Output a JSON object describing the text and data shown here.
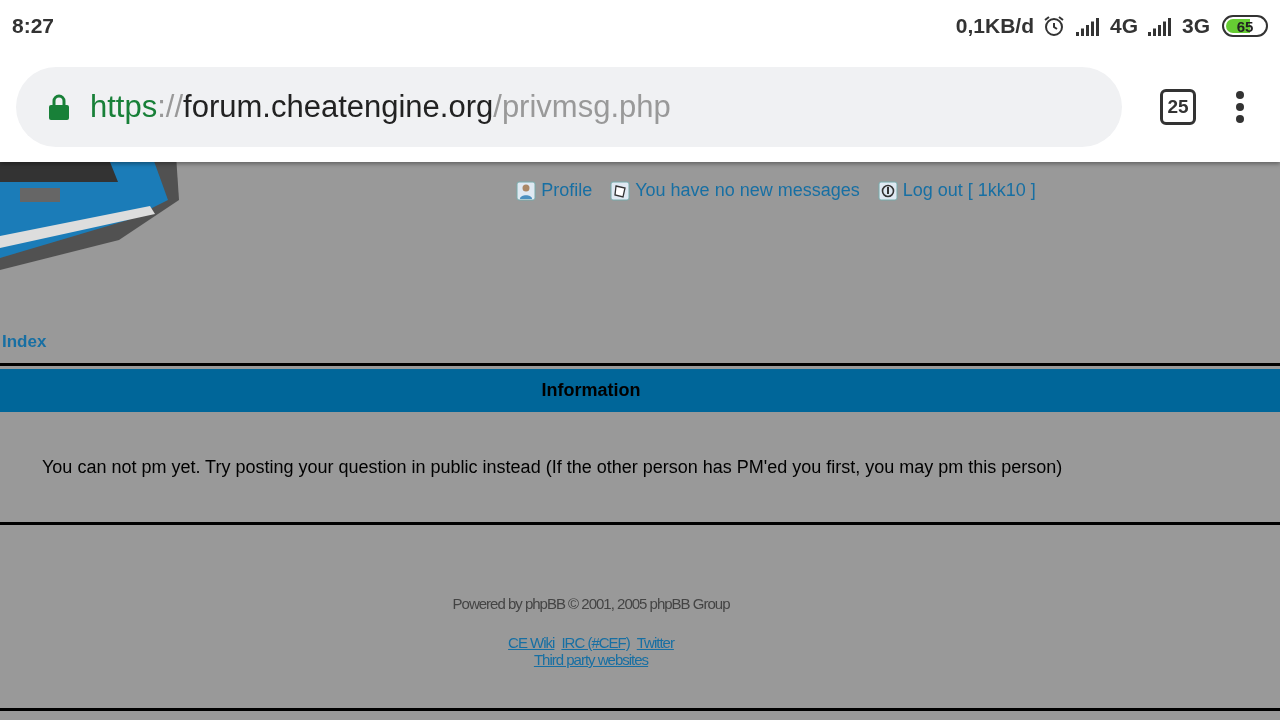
{
  "status_bar": {
    "time": "8:27",
    "data_rate": "0,1KB/d",
    "networks": [
      "4G",
      "3G"
    ],
    "battery": "65"
  },
  "address_bar": {
    "scheme": "https",
    "separator": "://",
    "host": "forum.cheatengine.org",
    "path": "/privmsg.php",
    "tab_count": "25"
  },
  "nav_links": [
    {
      "label": "Profile"
    },
    {
      "label": "You have no new messages"
    },
    {
      "label": "Log out [ 1kk10 ]"
    }
  ],
  "breadcrumb": "Index",
  "panel": {
    "title": "Information",
    "message": "You can not pm yet. Try posting your question in public instead (If the other person has PM'ed you first, you may pm this person)"
  },
  "footer": {
    "powered": "Powered by phpBB © 2001, 2005 phpBB Group",
    "links": [
      [
        "CE Wiki",
        "IRC (#CEF)",
        "Twitter"
      ],
      [
        "Third party websites"
      ]
    ]
  }
}
